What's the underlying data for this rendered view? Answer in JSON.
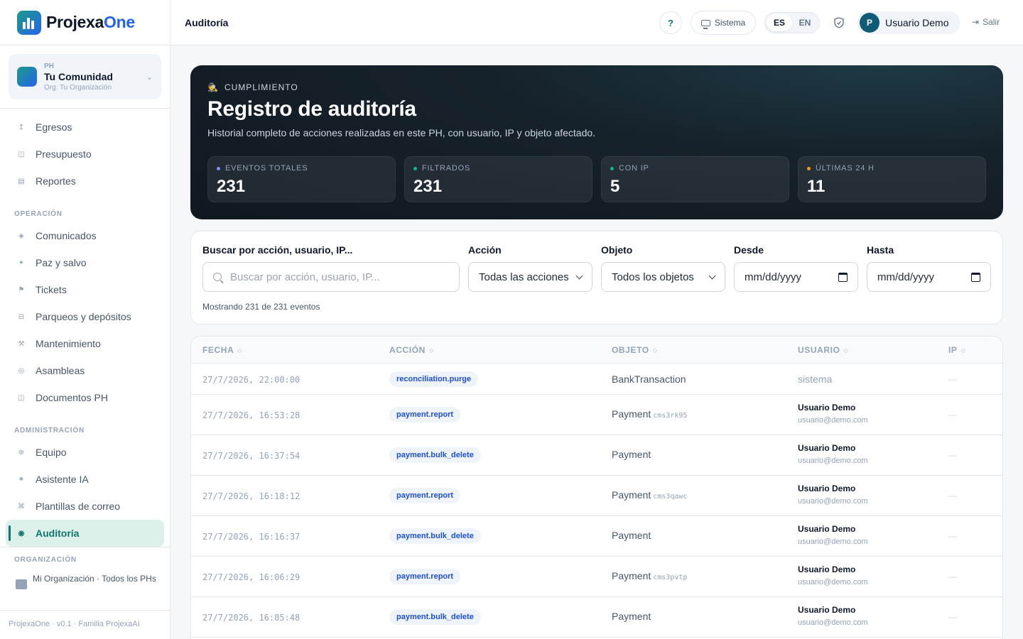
{
  "brand": {
    "name_main": "Projexa",
    "name_accent": "One"
  },
  "ph_selector": {
    "kind": "PH",
    "name": "Tu Comunidad",
    "org": "Org: Tu Organización"
  },
  "nav": {
    "top_items": [
      {
        "label": "Egresos",
        "icon": "arrow-up-icon"
      },
      {
        "label": "Presupuesto",
        "icon": "grid-icon"
      },
      {
        "label": "Reportes",
        "icon": "report-icon"
      }
    ],
    "section_operacion": "OPERACIÓN",
    "operacion_items": [
      {
        "label": "Comunicados",
        "icon": "megaphone-icon"
      },
      {
        "label": "Paz y salvo",
        "icon": "sparkle-icon"
      },
      {
        "label": "Tickets",
        "icon": "flag-icon"
      },
      {
        "label": "Parqueos y depósitos",
        "icon": "parking-icon"
      },
      {
        "label": "Mantenimiento",
        "icon": "wrench-icon"
      },
      {
        "label": "Asambleas",
        "icon": "circle-icon"
      },
      {
        "label": "Documentos PH",
        "icon": "document-icon"
      }
    ],
    "section_admin": "ADMINISTRACIÓN",
    "admin_items": [
      {
        "label": "Equipo",
        "icon": "team-icon"
      },
      {
        "label": "Asistente IA",
        "icon": "ai-icon"
      },
      {
        "label": "Plantillas de correo",
        "icon": "command-icon"
      },
      {
        "label": "Auditoría",
        "icon": "audit-icon",
        "active": true
      }
    ],
    "section_org": "ORGANIZACIÓN",
    "org_item": "Mi Organización · Todos los PHs"
  },
  "footer": "ProjexaOne · v0.1 · Familia ProjexaAI",
  "topbar": {
    "title": "Auditoría",
    "help": "?",
    "system": "Sistema",
    "lang_es": "ES",
    "lang_en": "EN",
    "user_initial": "P",
    "user_name": "Usuario Demo",
    "logout": "Salir"
  },
  "hero": {
    "eyebrow_icon": "🕵",
    "eyebrow": "CUMPLIMIENTO",
    "title": "Registro de auditoría",
    "subtitle": "Historial completo de acciones realizadas en este PH, con usuario, IP y objeto afectado.",
    "stats": [
      {
        "label": "EVENTOS TOTALES",
        "value": "231",
        "dot": "#818cf8"
      },
      {
        "label": "FILTRADOS",
        "value": "231",
        "dot": "#10b981"
      },
      {
        "label": "CON IP",
        "value": "5",
        "dot": "#10b981"
      },
      {
        "label": "ÚLTIMAS 24 H",
        "value": "11",
        "dot": "#f59e0b"
      }
    ]
  },
  "filters": {
    "search_label": "Buscar por acción, usuario, IP...",
    "search_placeholder": "Buscar por acción, usuario, IP...",
    "action_label": "Acción",
    "action_value": "Todas las acciones",
    "object_label": "Objeto",
    "object_value": "Todos los objetos",
    "from_label": "Desde",
    "from_value": "mm/dd/yyyy",
    "to_label": "Hasta",
    "to_value": "mm/dd/yyyy",
    "count_text": "Mostrando 231 de 231 eventos"
  },
  "table": {
    "headers": [
      "FECHA",
      "ACCIÓN",
      "OBJETO",
      "USUARIO",
      "IP"
    ],
    "rows": [
      {
        "date": "27/7/2026, 22:00:00",
        "action": "reconciliation.purge",
        "object": "BankTransaction",
        "object_id": "",
        "user_name": "",
        "user_email": "",
        "system_user": "sistema",
        "ip": "—"
      },
      {
        "date": "27/7/2026, 16:53:28",
        "action": "payment.report",
        "object": "Payment",
        "object_id": "cms3rk95",
        "user_name": "Usuario Demo",
        "user_email": "usuario@demo.com",
        "ip": "—"
      },
      {
        "date": "27/7/2026, 16:37:54",
        "action": "payment.bulk_delete",
        "object": "Payment",
        "object_id": "",
        "user_name": "Usuario Demo",
        "user_email": "usuario@demo.com",
        "ip": "—"
      },
      {
        "date": "27/7/2026, 16:18:12",
        "action": "payment.report",
        "object": "Payment",
        "object_id": "cms3qawc",
        "user_name": "Usuario Demo",
        "user_email": "usuario@demo.com",
        "ip": "—"
      },
      {
        "date": "27/7/2026, 16:16:37",
        "action": "payment.bulk_delete",
        "object": "Payment",
        "object_id": "",
        "user_name": "Usuario Demo",
        "user_email": "usuario@demo.com",
        "ip": "—"
      },
      {
        "date": "27/7/2026, 16:06:29",
        "action": "payment.report",
        "object": "Payment",
        "object_id": "cms3pvtp",
        "user_name": "Usuario Demo",
        "user_email": "usuario@demo.com",
        "ip": "—"
      },
      {
        "date": "27/7/2026, 16:05:48",
        "action": "payment.bulk_delete",
        "object": "Payment",
        "object_id": "",
        "user_name": "Usuario Demo",
        "user_email": "usuario@demo.com",
        "ip": "—"
      }
    ]
  }
}
